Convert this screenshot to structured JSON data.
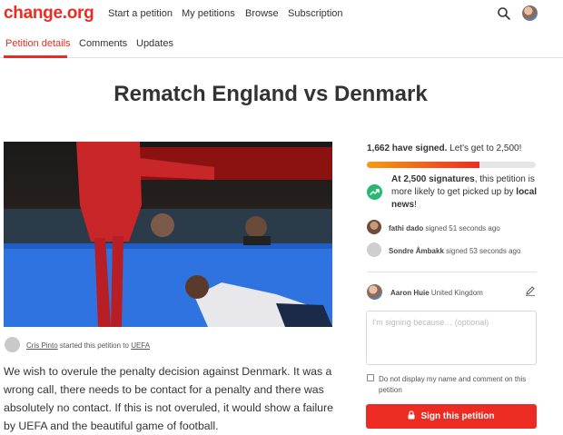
{
  "header": {
    "logo": "change.org",
    "nav": [
      "Start a petition",
      "My petitions",
      "Browse",
      "Subscription"
    ]
  },
  "tabs": [
    "Petition details",
    "Comments",
    "Updates"
  ],
  "title": "Rematch England vs Denmark",
  "starter": {
    "name": "Cris Pinto",
    "action": " started this petition to ",
    "target": "UEFA"
  },
  "description": "We wish to overule the penalty decision against Denmark. It was a wrong call, there needs to be contact for a penalty and there was absolutely no contact. If this is not overuled, it would show a failure by UEFA and the beautiful game of football.",
  "signatures": {
    "count": "1,662 have signed.",
    "goal_text": " Let's get to 2,500!",
    "progress_fraction": 0.6648
  },
  "milestone": {
    "bold": "At 2,500 signatures",
    "mid": ", this petition is more likely to get picked up by ",
    "bold2": "local news",
    "end": "!"
  },
  "recent_signers": [
    {
      "name": "fathi dado",
      "time": "signed 51 seconds ago"
    },
    {
      "name": "Sondre Åmbakk",
      "time": "signed 53 seconds ago"
    }
  ],
  "current_user": {
    "name": "Aaron Huie",
    "country": "United Kingdom"
  },
  "reason_placeholder": "I'm signing because… (optional)",
  "hide_name_label": "Do not display my name and comment on this petition",
  "sign_button": "Sign this petition",
  "colors": {
    "brand": "#ec2c22",
    "progress_start": "#f39c12",
    "trend": "#2bb673"
  }
}
